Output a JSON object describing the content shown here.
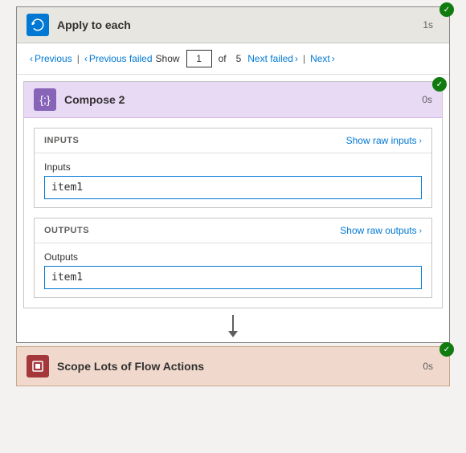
{
  "header": {
    "title": "Apply to each",
    "duration": "1s",
    "icon": "loop-icon"
  },
  "pagination": {
    "previous_label": "Previous",
    "previous_failed_label": "Previous failed",
    "show_label": "Show",
    "current_page": "1",
    "total_pages": "5",
    "next_failed_label": "Next failed",
    "next_label": "Next"
  },
  "compose": {
    "title": "Compose 2",
    "duration": "0s",
    "icon": "compose-icon",
    "inputs_section": {
      "label": "INPUTS",
      "show_raw_label": "Show raw inputs",
      "field_label": "Inputs",
      "field_value": "item1"
    },
    "outputs_section": {
      "label": "OUTPUTS",
      "show_raw_label": "Show raw outputs",
      "field_label": "Outputs",
      "field_value": "item1"
    }
  },
  "scope": {
    "title": "Scope Lots of Flow Actions",
    "duration": "0s",
    "icon": "scope-icon"
  },
  "colors": {
    "success_green": "#107c10",
    "blue_accent": "#0078d4",
    "compose_purple": "#8764b8",
    "scope_red": "#a4373a",
    "header_bg": "#e8e6e0",
    "scope_bg": "#f0d9cc"
  }
}
